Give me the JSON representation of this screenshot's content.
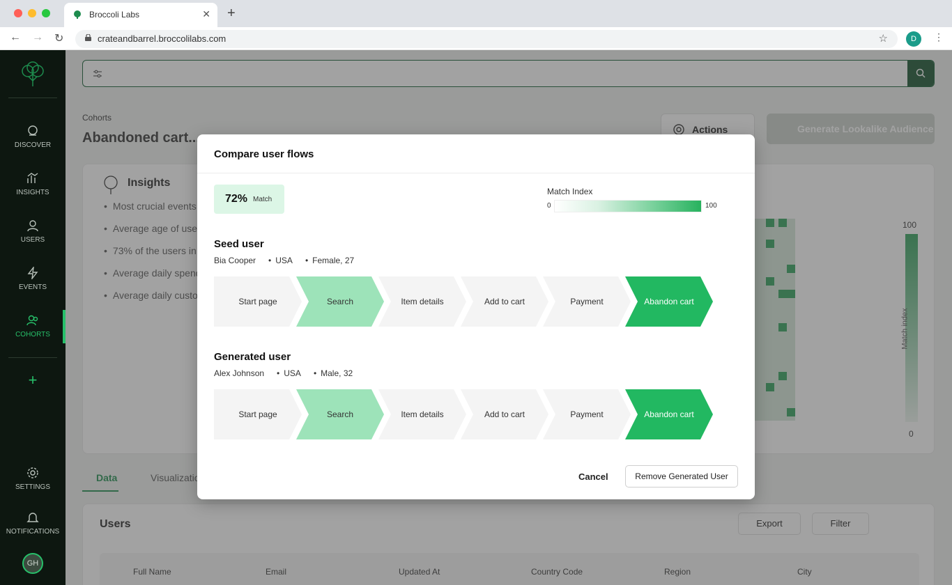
{
  "browser": {
    "tab_title": "Broccoli Labs",
    "url": "crateandbarrel.broccolilabs.com",
    "profile_initial": "D"
  },
  "sidebar": {
    "items": [
      {
        "label": "DISCOVER",
        "icon": "globe-icon"
      },
      {
        "label": "INSIGHTS",
        "icon": "insights-icon"
      },
      {
        "label": "USERS",
        "icon": "user-icon"
      },
      {
        "label": "EVENTS",
        "icon": "bolt-icon"
      },
      {
        "label": "COHORTS",
        "icon": "users-icon"
      }
    ],
    "bottom": [
      {
        "label": "SETTINGS",
        "icon": "gear-icon"
      },
      {
        "label": "NOTIFICATIONS",
        "icon": "bell-icon"
      }
    ],
    "avatar_initials": "GH"
  },
  "page": {
    "breadcrumb": "Cohorts",
    "title": "Abandoned cart...",
    "actions_label": "Actions",
    "generate_label": "Generate Lookalike Audience"
  },
  "insights": {
    "title": "Insights",
    "items": [
      "Most crucial events",
      "Average age of user",
      "73% of the users in",
      "Average daily spend",
      "Average daily custo"
    ],
    "legend_max": "100",
    "legend_min": "0",
    "legend_axis": "Match index"
  },
  "tabs": {
    "data": "Data",
    "visualization": "Visualizatio"
  },
  "users_panel": {
    "title": "Users",
    "export": "Export",
    "filter": "Filter",
    "columns": [
      "Full Name",
      "Email",
      "Updated At",
      "Country Code",
      "Region",
      "City"
    ]
  },
  "modal": {
    "title": "Compare user flows",
    "match_value": "72%",
    "match_label": "Match",
    "match_index_title": "Match Index",
    "match_index_min": "0",
    "match_index_max": "100",
    "cancel": "Cancel",
    "remove": "Remove Generated User",
    "seed": {
      "heading": "Seed user",
      "name": "Bia Cooper",
      "country": "USA",
      "demo": "Female, 27",
      "steps": [
        {
          "label": "Start page",
          "level": "none"
        },
        {
          "label": "Search",
          "level": "light"
        },
        {
          "label": "Item details",
          "level": "none"
        },
        {
          "label": "Add to cart",
          "level": "none"
        },
        {
          "label": "Payment",
          "level": "none"
        },
        {
          "label": "Abandon cart",
          "level": "strong"
        }
      ]
    },
    "generated": {
      "heading": "Generated user",
      "name": "Alex Johnson",
      "country": "USA",
      "demo": "Male, 32",
      "steps": [
        {
          "label": "Start page",
          "level": "none"
        },
        {
          "label": "Search",
          "level": "light"
        },
        {
          "label": "Item details",
          "level": "none"
        },
        {
          "label": "Add to cart",
          "level": "none"
        },
        {
          "label": "Payment",
          "level": "none"
        },
        {
          "label": "Abandon cart",
          "level": "strong"
        }
      ]
    }
  },
  "colors": {
    "accent": "#27c06a",
    "step_none": "#f4f4f4",
    "step_light": "#9de3b9",
    "step_strong": "#22b861"
  }
}
